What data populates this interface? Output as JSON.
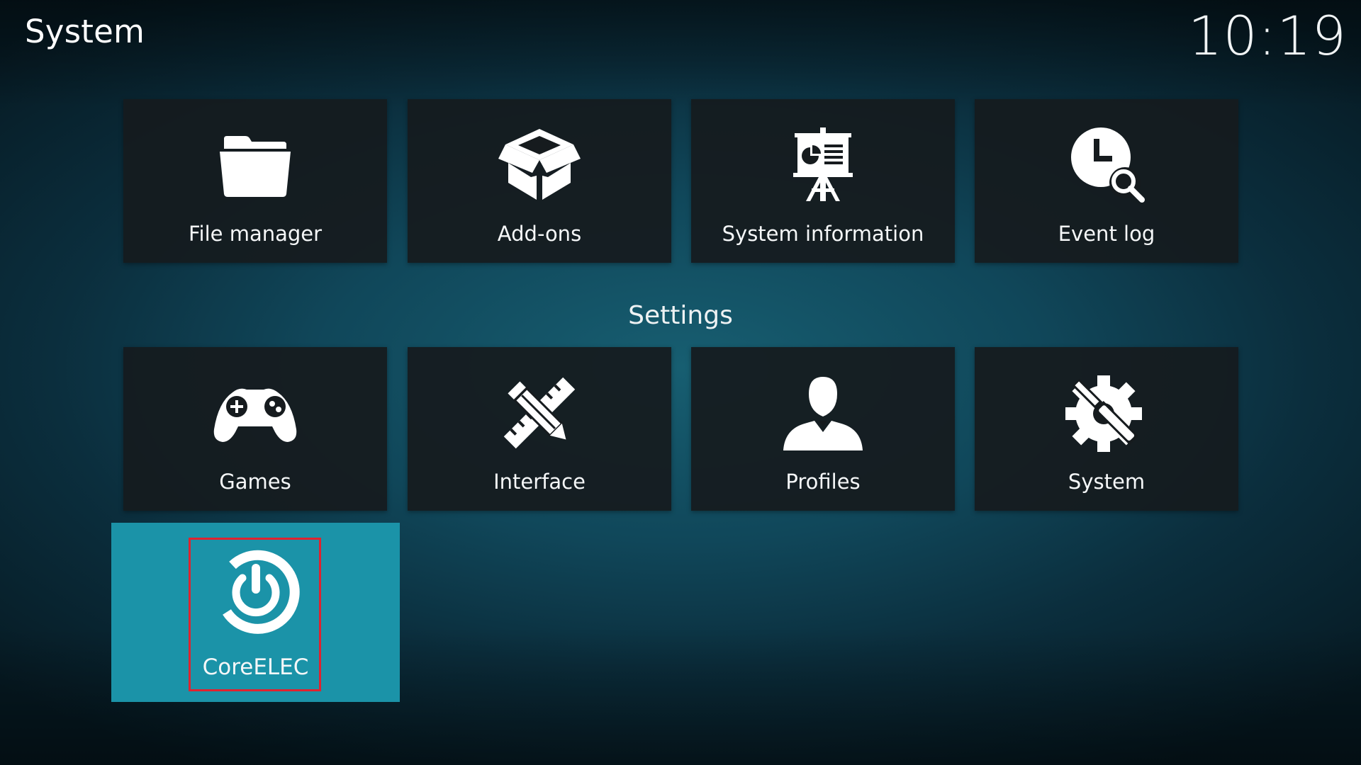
{
  "header": {
    "title": "System",
    "clock": "10:19"
  },
  "top_row": [
    {
      "label": "File manager",
      "icon": "folder-icon"
    },
    {
      "label": "Add-ons",
      "icon": "box-icon"
    },
    {
      "label": "System information",
      "icon": "presentation-icon"
    },
    {
      "label": "Event log",
      "icon": "clock-search-icon"
    }
  ],
  "settings": {
    "heading": "Settings",
    "items": [
      {
        "label": "Games",
        "icon": "gamepad-icon"
      },
      {
        "label": "Interface",
        "icon": "pencil-ruler-icon"
      },
      {
        "label": "Profiles",
        "icon": "person-icon"
      },
      {
        "label": "System",
        "icon": "gear-tools-icon"
      }
    ]
  },
  "addons": {
    "items": [
      {
        "label": "CoreELEC",
        "icon": "power-icon",
        "focused": true
      }
    ]
  },
  "colors": {
    "focus_tile": "#1b93a8",
    "tile_background": "#161b1e",
    "highlight_border": "#e0232f"
  }
}
